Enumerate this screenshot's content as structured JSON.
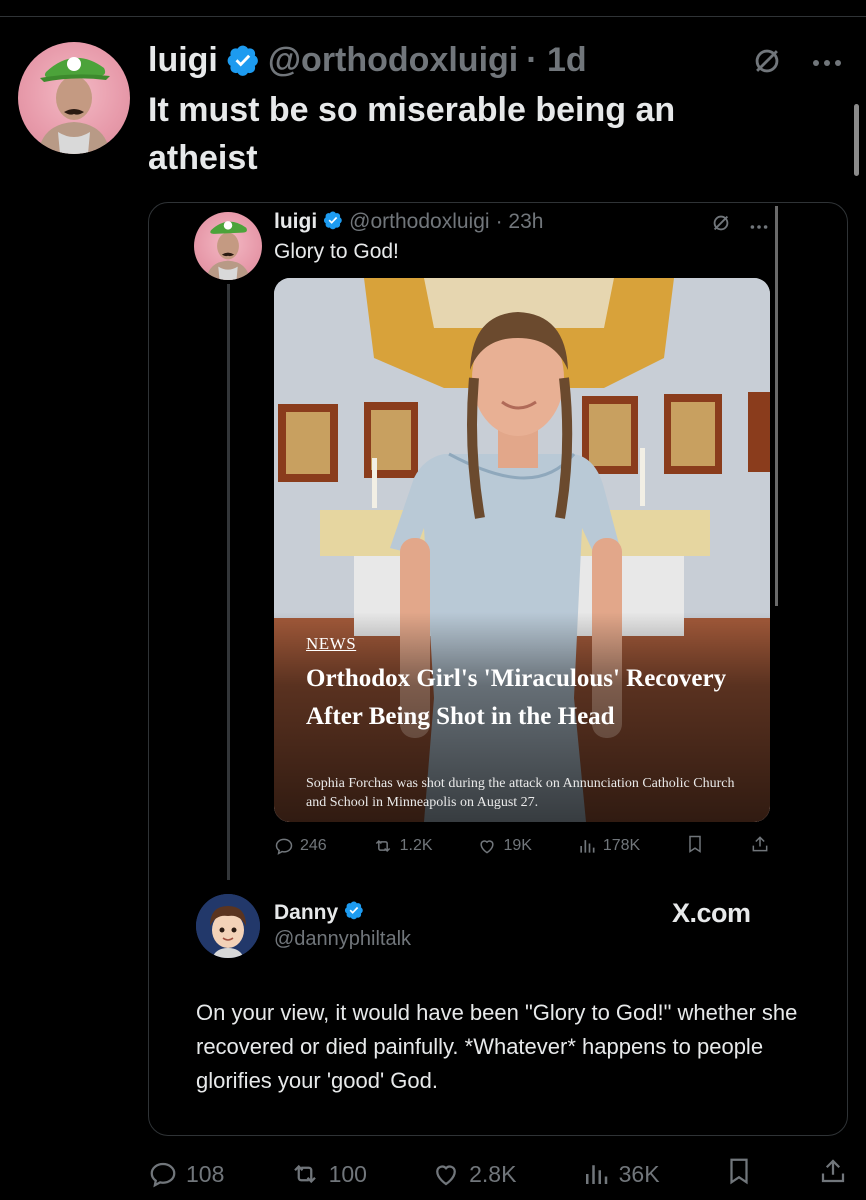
{
  "tweet": {
    "author_name": "luigi",
    "author_handle": "@orthodoxluigi",
    "time": "· 1d",
    "text": "It must be so miserable being an atheist",
    "stats": {
      "replies": "108",
      "reposts": "100",
      "likes": "2.8K",
      "views": "36K"
    }
  },
  "quoted": {
    "author_name": "luigi",
    "author_handle": "@orthodoxluigi",
    "time": "· 23h",
    "text": "Glory to God!",
    "media": {
      "tag": "NEWS",
      "headline": "Orthodox Girl's 'Miraculous' Recovery After Being Shot in the Head",
      "caption": "Sophia Forchas was shot during the attack on Annunciation Catholic Church and School in Minneapolis on August 27."
    },
    "stats": {
      "replies": "246",
      "reposts": "1.2K",
      "likes": "19K",
      "views": "178K"
    }
  },
  "reply": {
    "author_name": "Danny",
    "author_handle": "@dannyphiltalk",
    "site": "X.com",
    "text": "On your view, it would have been \"Glory to God!\" whether she recovered or died painfully. *Whatever* happens to people glorifies your 'good' God."
  },
  "icons": [
    "verified-badge-icon",
    "grok-icon",
    "more-icon",
    "reply-icon",
    "repost-icon",
    "like-icon",
    "views-icon",
    "bookmark-icon",
    "share-icon"
  ],
  "colors": {
    "background": "#000000",
    "text": "#e7e9ea",
    "muted": "#71767b",
    "verified": "#1d9bf0",
    "border": "#2f3336"
  }
}
